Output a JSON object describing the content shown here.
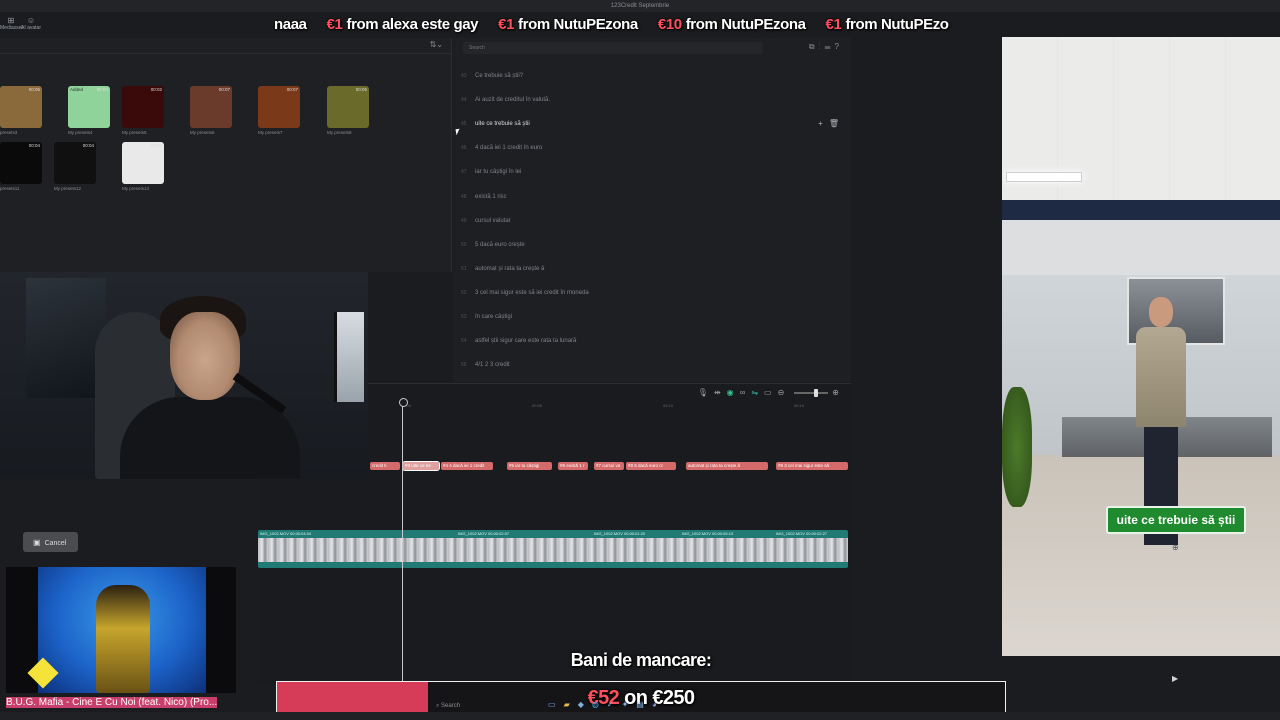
{
  "window": {
    "title": "123Credit Septembrie"
  },
  "ticker": {
    "items": [
      {
        "amount": "",
        "text": "naaa"
      },
      {
        "amount": "€1",
        "text": "from alexa este gay"
      },
      {
        "amount": "€1",
        "text": "from NutuPEzona"
      },
      {
        "amount": "€10",
        "text": "from NutuPEzona"
      },
      {
        "amount": "€1",
        "text": "from NutuPEzo"
      }
    ]
  },
  "media_panel": {
    "tools": [
      {
        "label": "Mediasset",
        "icon": "import-icon"
      },
      {
        "label": "AI avatar",
        "icon": "avatar-icon"
      }
    ],
    "thumbs": [
      {
        "label": "presets3",
        "duration": "00:05",
        "tag": "",
        "color": "#8a6a3a"
      },
      {
        "label": "My presets4",
        "duration": "00:04",
        "tag": "Added",
        "color": "#8fd39b"
      },
      {
        "label": "My presets5",
        "duration": "00:02",
        "tag": "",
        "color": "#3a0a0a"
      },
      {
        "label": "My presets6",
        "duration": "00:07",
        "tag": "",
        "color": "#6a3a2a"
      },
      {
        "label": "My presets7",
        "duration": "00:07",
        "tag": "",
        "color": "#7a3a1a"
      },
      {
        "label": "My presets8",
        "duration": "00:05",
        "tag": "",
        "color": "#6a6a2a"
      },
      {
        "label": "presets11",
        "duration": "00:04",
        "tag": "",
        "color": "#0a0a0a"
      },
      {
        "label": "My presets12",
        "duration": "00:04",
        "tag": "",
        "color": "#101010"
      },
      {
        "label": "My presets13",
        "duration": "00:01",
        "tag": "",
        "color": "#e9e9e9"
      }
    ]
  },
  "captions": {
    "search_placeholder": "Search",
    "rows": [
      {
        "num": "43",
        "text": "Ce trebuie să știi?"
      },
      {
        "num": "44",
        "text": "Ai auzit de creditul în valută."
      },
      {
        "num": "45",
        "text": "uite ce trebuie să știi",
        "active": true
      },
      {
        "num": "46",
        "text": "4 dacă iei 1 credit în euro"
      },
      {
        "num": "47",
        "text": "iar tu câștigi în lei"
      },
      {
        "num": "48",
        "text": "există 1 risc"
      },
      {
        "num": "49",
        "text": "cursul valutar"
      },
      {
        "num": "50",
        "text": "5 dacă euro crește"
      },
      {
        "num": "51",
        "text": "automat și rata ta crește â"
      },
      {
        "num": "52",
        "text": "3 cel mai sigur este să iei credit în moneda"
      },
      {
        "num": "53",
        "text": "în care câștigi"
      },
      {
        "num": "54",
        "text": "astfel știi sigur care este rata ta lunară"
      },
      {
        "num": "55",
        "text": "4/1 2 3 credit"
      }
    ]
  },
  "timeline": {
    "ruler": [
      "00:00",
      "00:05",
      "00:10",
      "00:15"
    ],
    "caption_clips": [
      {
        "text": "credit ti",
        "selected": false
      },
      {
        "text": "#3 uite ce tre",
        "selected": true
      },
      {
        "text": "#4 4 dacă iei 1 credit",
        "selected": false
      },
      {
        "text": "#5 iar tu câștigi",
        "selected": false
      },
      {
        "text": "#6 există 1 r",
        "selected": false
      },
      {
        "text": "#7 cursul va",
        "selected": false
      },
      {
        "text": "#8 5 dacă euro cr",
        "selected": false
      },
      {
        "text": "automat și rata ta crește â",
        "selected": false
      },
      {
        "text": "#9 3 cel mai sigur este să",
        "selected": false
      }
    ],
    "video_clips": [
      "IMG_1002.MOV 00:00:04:04",
      "IMG_1002.MOV 00:00:02:07",
      "IMG_1002.MOV 00:00:01:20",
      "IMG_1002.MOV 00:00:05:13",
      "IMG_1002.MOV 00:00:02:27"
    ]
  },
  "cancel_label": "Cancel",
  "now_playing": "B.U.G. Mafia - Cine E Cu Noi (feat. Nico) (Pro...",
  "preview": {
    "subtitle": "uite ce trebuie să știi"
  },
  "goal": {
    "title": "Bani de mancare:",
    "current": "€52",
    "joiner": "on",
    "target": "€250",
    "progress": 0.208,
    "fill_color": "#d63c58"
  },
  "taskbar": {
    "search_placeholder": "Search"
  },
  "colors": {
    "caption_clip": "#d46a6a",
    "video_track": "#1f7b74",
    "subtitle_bg": "#1f8a2e",
    "donation": "#ff4f5c"
  }
}
